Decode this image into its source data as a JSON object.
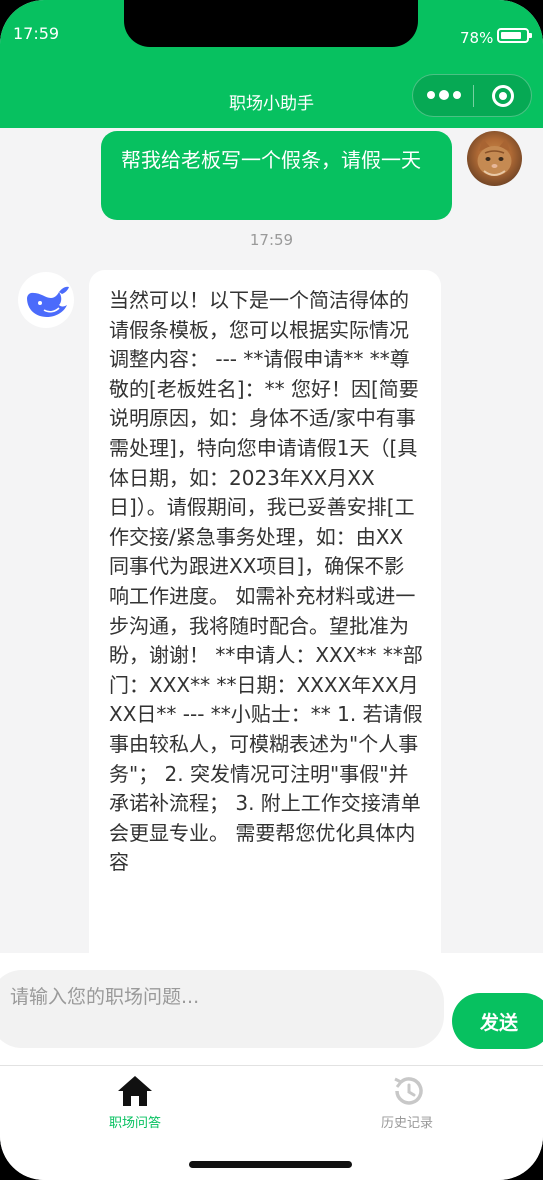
{
  "status_bar": {
    "time": "17:59",
    "battery": "78%"
  },
  "header": {
    "title": "职场小助手",
    "more_icon": "more-dots-icon",
    "close_icon": "target-icon"
  },
  "messages": [
    {
      "role": "user",
      "text": "帮我给老板写一个假条，请假一天"
    },
    {
      "role": "timestamp",
      "text": "17:59"
    },
    {
      "role": "assistant",
      "text": "当然可以！以下是一个简洁得体的请假条模板，您可以根据实际情况调整内容： --- **请假申请** **尊敬的[老板姓名]：** 您好！因[简要说明原因，如：身体不适/家中有事需处理]，特向您申请请假1天（[具体日期，如：2023年XX月XX日]）。请假期间，我已妥善安排[工作交接/紧急事务处理，如：由XX同事代为跟进XX项目]，确保不影响工作进度。 如需补充材料或进一步沟通，我将随时配合。望批准为盼，谢谢！ **申请人：XXX** **部门：XXX** **日期：XXXX年XX月XX日** --- **小贴士：** 1. 若请假事由较私人，可模糊表述为\"个人事务\"； 2. 突发情况可注明\"事假\"并承诺补流程； 3. 附上工作交接清单会更显专业。 需要帮您优化具体内容"
    }
  ],
  "composer": {
    "placeholder": "请输入您的职场问题...",
    "send_label": "发送"
  },
  "tabbar": [
    {
      "label": "职场问答",
      "icon": "home-icon",
      "active": true
    },
    {
      "label": "历史记录",
      "icon": "history-icon",
      "active": false
    }
  ],
  "colors": {
    "brand": "#07c160",
    "background": "#f4f4f5",
    "inactive": "#9a9a9a"
  }
}
